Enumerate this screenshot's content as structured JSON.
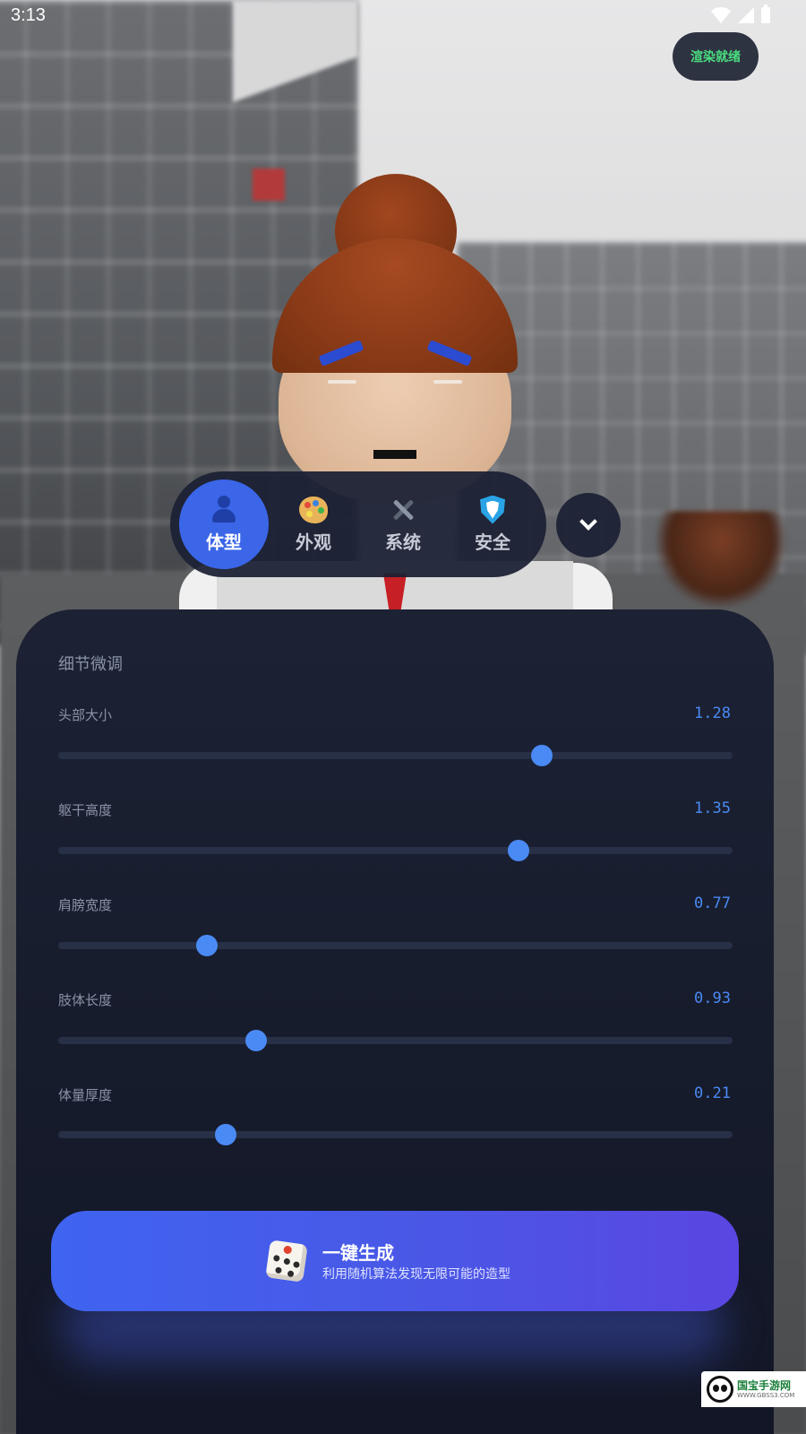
{
  "status_bar": {
    "time": "3:13",
    "icons": [
      "wifi-icon",
      "signal-icon",
      "battery-icon"
    ]
  },
  "render_status": {
    "label": "渲染就绪",
    "color": "#4ade80"
  },
  "tabs": [
    {
      "label": "体型",
      "icon": "person-icon",
      "active": true
    },
    {
      "label": "外观",
      "icon": "palette-icon",
      "active": false
    },
    {
      "label": "系统",
      "icon": "tools-icon",
      "active": false
    },
    {
      "label": "安全",
      "icon": "shield-icon",
      "active": false
    }
  ],
  "expand_button": {
    "icon": "chevron-down-icon"
  },
  "panel": {
    "title": "细节微调",
    "sliders": [
      {
        "label": "头部大小",
        "value": "1.28",
        "fraction": 0.717
      },
      {
        "label": "躯干高度",
        "value": "1.35",
        "fraction": 0.682
      },
      {
        "label": "肩膀宽度",
        "value": "0.77",
        "fraction": 0.221
      },
      {
        "label": "肢体长度",
        "value": "0.93",
        "fraction": 0.293
      },
      {
        "label": "体量厚度",
        "value": "0.21",
        "fraction": 0.249
      }
    ]
  },
  "generate_button": {
    "title": "一键生成",
    "subtitle": "利用随机算法发现无限可能的造型",
    "icon": "dice-icon"
  },
  "watermark": {
    "title": "国宝手游网",
    "url": "WWW.GBSS3.COM"
  },
  "colors": {
    "accent": "#3b66e8",
    "slider": "#4a8af4",
    "panel": "#1c2234"
  }
}
